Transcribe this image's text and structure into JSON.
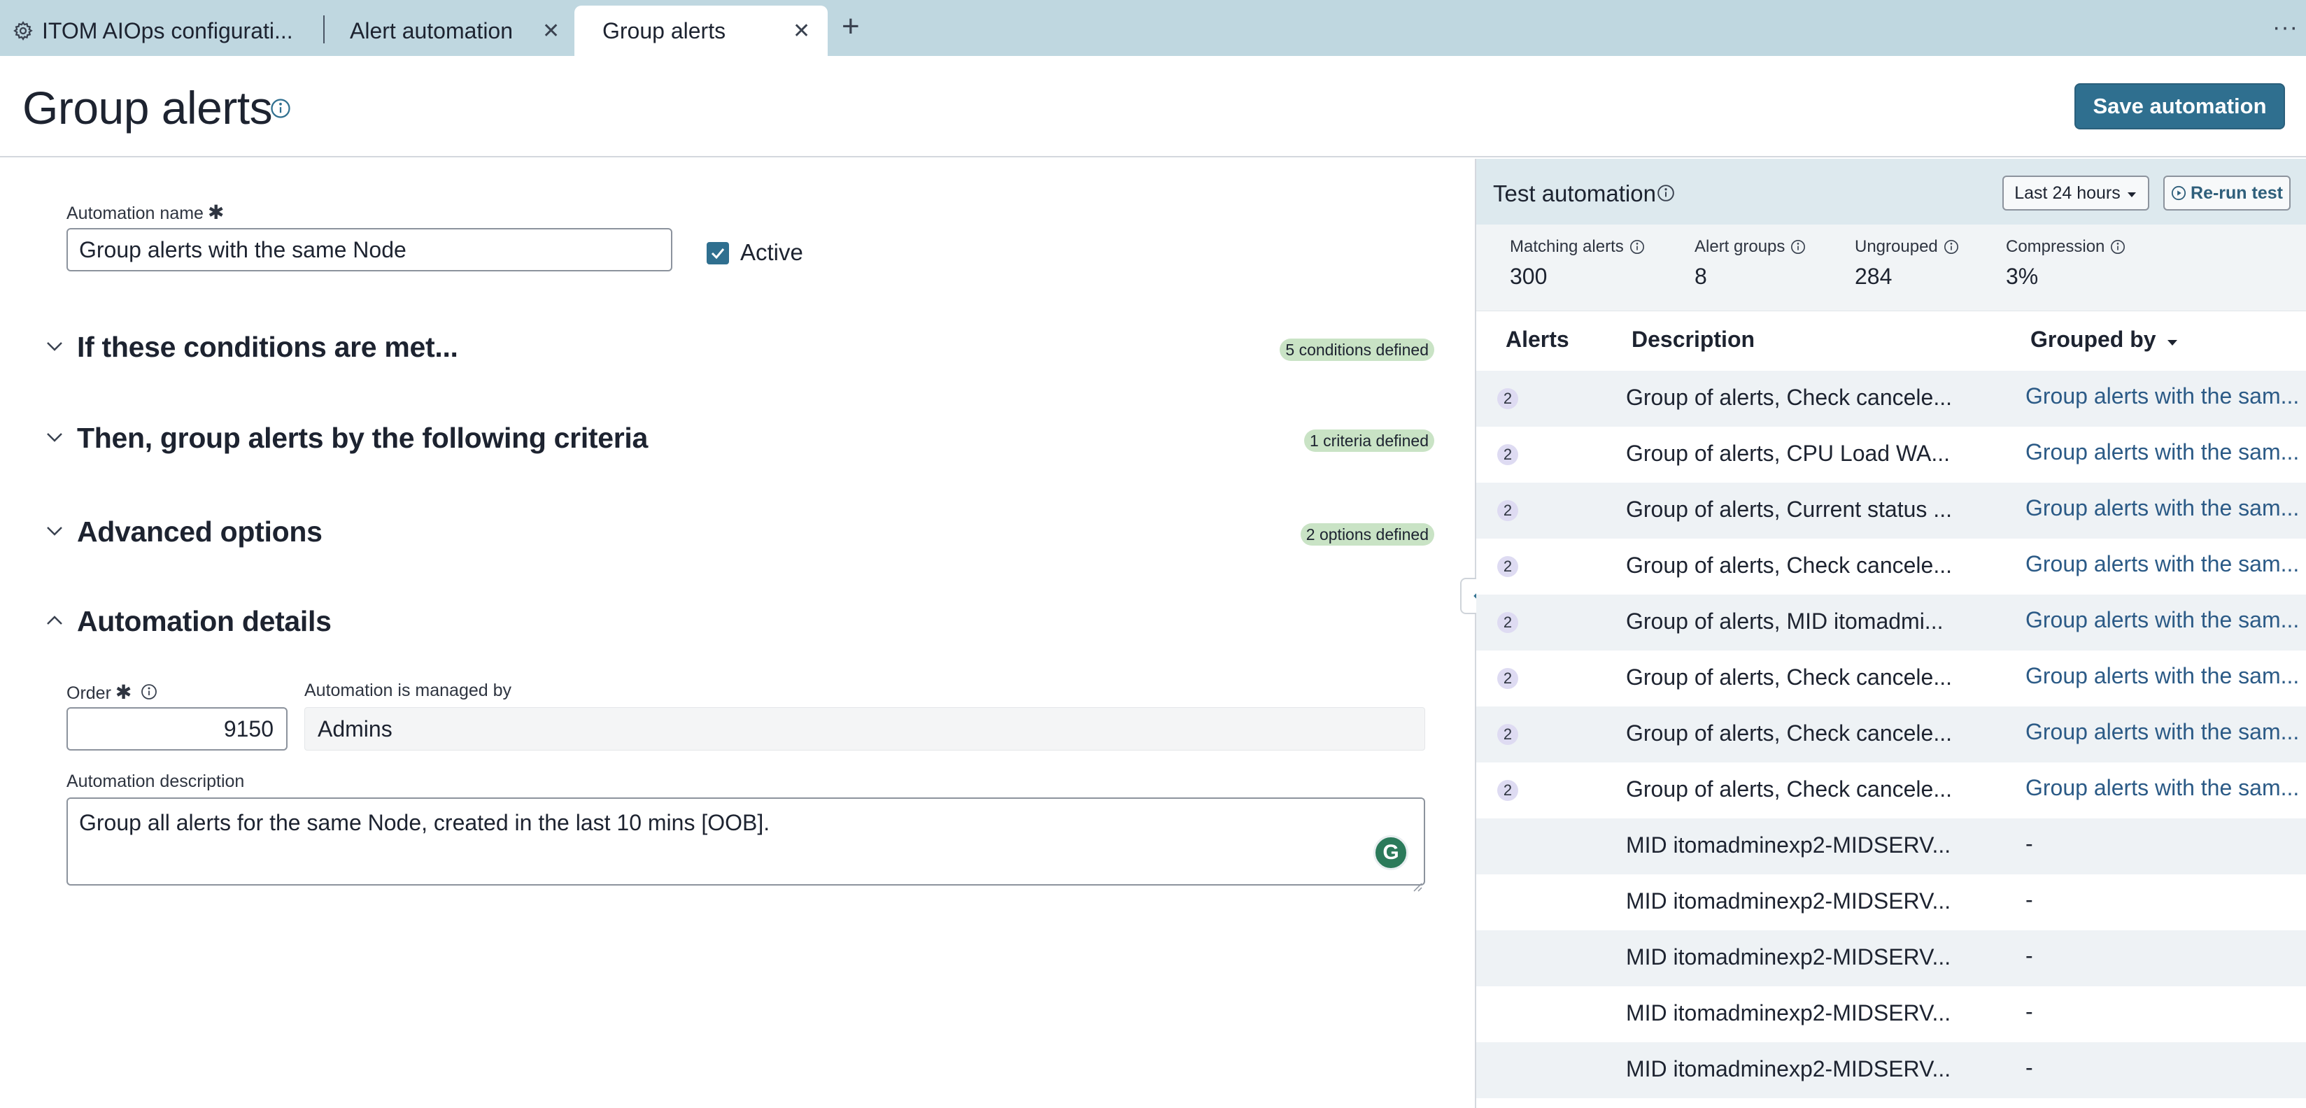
{
  "tabs": [
    {
      "label": "ITOM AIOps configurati...",
      "icon": "gear-icon"
    },
    {
      "label": "Alert automation"
    },
    {
      "label": "Group alerts",
      "active": true
    }
  ],
  "header": {
    "title": "Group alerts",
    "save_label": "Save automation"
  },
  "form": {
    "name_label": "Automation name",
    "name_value": "Group alerts with the same Node",
    "active_label": "Active",
    "active_checked": true,
    "sections": [
      {
        "title": "If these conditions are met...",
        "badge": "5 conditions defined",
        "expanded": false
      },
      {
        "title": "Then, group alerts by the following criteria",
        "badge": "1 criteria defined",
        "expanded": false
      },
      {
        "title": "Advanced options",
        "badge": "2 options defined",
        "expanded": false
      },
      {
        "title": "Automation details",
        "badge": "",
        "expanded": true
      }
    ],
    "order_label": "Order",
    "order_value": "9150",
    "managed_label": "Automation is managed by",
    "managed_value": "Admins",
    "description_label": "Automation description",
    "description_value": "Group all alerts for the same Node, created in the last 10 mins [OOB]."
  },
  "test": {
    "title": "Test automation",
    "range_label": "Last 24 hours",
    "rerun_label": "Re-run test",
    "stats": [
      {
        "label": "Matching alerts",
        "value": "300"
      },
      {
        "label": "Alert groups",
        "value": "8"
      },
      {
        "label": "Ungrouped",
        "value": "284"
      },
      {
        "label": "Compression",
        "value": "3%"
      }
    ],
    "columns": [
      "Alerts",
      "Description",
      "Grouped by"
    ],
    "rows": [
      {
        "count": "2",
        "description": "Group of alerts, Check cancele...",
        "grouped_by": "Group alerts with the sam..."
      },
      {
        "count": "2",
        "description": "Group of alerts, CPU Load WA...",
        "grouped_by": "Group alerts with the sam..."
      },
      {
        "count": "2",
        "description": "Group of alerts, Current status ...",
        "grouped_by": "Group alerts with the sam..."
      },
      {
        "count": "2",
        "description": "Group of alerts, Check cancele...",
        "grouped_by": "Group alerts with the sam..."
      },
      {
        "count": "2",
        "description": "Group of alerts, MID itomadmi...",
        "grouped_by": "Group alerts with the sam..."
      },
      {
        "count": "2",
        "description": "Group of alerts, Check cancele...",
        "grouped_by": "Group alerts with the sam..."
      },
      {
        "count": "2",
        "description": "Group of alerts, Check cancele...",
        "grouped_by": "Group alerts with the sam..."
      },
      {
        "count": "2",
        "description": "Group of alerts, Check cancele...",
        "grouped_by": "Group alerts with the sam..."
      },
      {
        "count": "",
        "description": "MID itomadminexp2-MIDSERV...",
        "grouped_by": "-"
      },
      {
        "count": "",
        "description": "MID itomadminexp2-MIDSERV...",
        "grouped_by": "-"
      },
      {
        "count": "",
        "description": "MID itomadminexp2-MIDSERV...",
        "grouped_by": "-"
      },
      {
        "count": "",
        "description": "MID itomadminexp2-MIDSERV...",
        "grouped_by": "-"
      },
      {
        "count": "",
        "description": "MID itomadminexp2-MIDSERV...",
        "grouped_by": "-"
      }
    ]
  },
  "colors": {
    "tabbar": "#bfd7e0",
    "primary": "#2f6f8f",
    "badge": "#c9e3c5",
    "link": "#2b5a86",
    "count_badge": "#dedbf2"
  }
}
